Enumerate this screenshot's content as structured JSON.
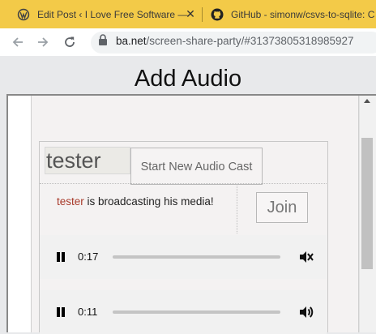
{
  "browser": {
    "tabs": [
      {
        "title": "Edit Post ‹ I Love Free Software — ",
        "close": "✕"
      },
      {
        "title": "GitHub - simonw/csvs-to-sqlite: C"
      }
    ],
    "url_host": "ba.net",
    "url_path": "/screen-share-party/#31373805318985927"
  },
  "page": {
    "title": "Add Audio",
    "name_input_value": "tester",
    "start_button_label": "Start New Audio Cast",
    "broadcast": {
      "user": "tester",
      "message": " is broadcasting his media!",
      "join_label": "Join"
    },
    "players": [
      {
        "time": "0:17",
        "state": "playing",
        "muted": true,
        "progress": 0
      },
      {
        "time": "0:11",
        "state": "playing",
        "muted": false,
        "progress": 0
      }
    ]
  },
  "colors": {
    "tab_strip": "#f3ca48",
    "broadcaster_name": "#a83a2a"
  }
}
